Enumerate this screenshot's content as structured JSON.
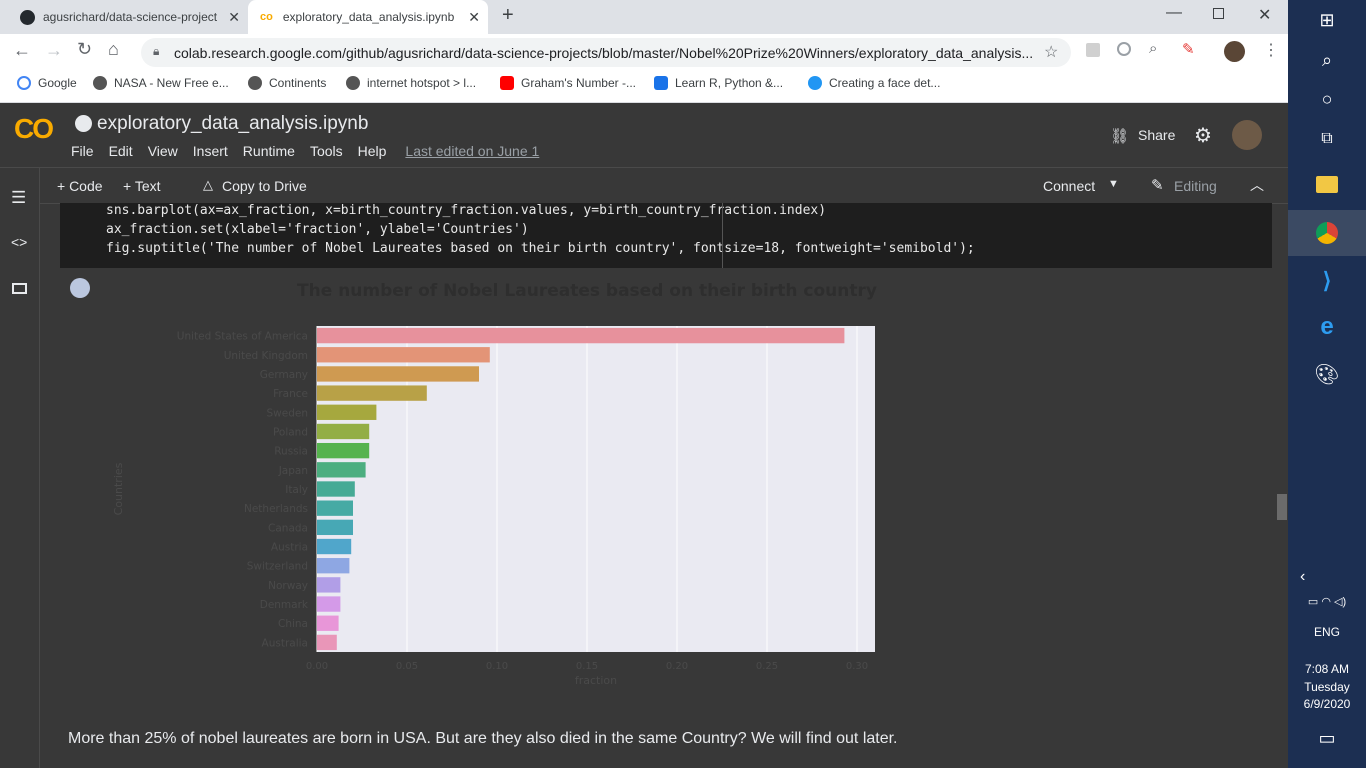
{
  "browser": {
    "tabs": [
      {
        "title": "agusrichard/data-science-project",
        "icon": "github-icon"
      },
      {
        "title": "exploratory_data_analysis.ipynb -",
        "icon": "colab-icon"
      }
    ],
    "url": "colab.research.google.com/github/agusrichard/data-science-projects/blob/master/Nobel%20Prize%20Winners/exploratory_data_analysis...",
    "bookmarks": [
      {
        "label": "Google",
        "color": "#4285f4"
      },
      {
        "label": "NASA - New Free e...",
        "color": "#555555"
      },
      {
        "label": "Continents",
        "color": "#555555"
      },
      {
        "label": "internet hotspot > l...",
        "color": "#555555"
      },
      {
        "label": "Graham's Number -...",
        "color": "#ff0000"
      },
      {
        "label": "Learn R, Python &...",
        "color": "#1a73e8"
      },
      {
        "label": "Creating a face det...",
        "color": "#2196f3"
      }
    ]
  },
  "colab": {
    "logo": "CO",
    "notebook_title": "exploratory_data_analysis.ipynb",
    "menu": [
      "File",
      "Edit",
      "View",
      "Insert",
      "Runtime",
      "Tools",
      "Help"
    ],
    "last_edited": "Last edited on June 1",
    "share_label": "Share",
    "add_code": "+ Code",
    "add_text": "+ Text",
    "copy_to_drive": "Copy to Drive",
    "connect": "Connect",
    "editing": "Editing"
  },
  "code_lines": [
    "sns.barplot(ax=ax_fraction, x=birth_country_fraction.values, y=birth_country_fraction.index)",
    "ax_fraction.set(xlabel='fraction', ylabel='Countries')",
    "fig.suptitle('The number of Nobel Laureates based on their birth country', fontsize=18, fontweight='semibold');"
  ],
  "chart_data": {
    "type": "bar",
    "orientation": "horizontal",
    "title": "The number of Nobel Laureates based on their birth country",
    "xlabel": "fraction",
    "ylabel": "Countries",
    "xlim": [
      0,
      0.31
    ],
    "xticks": [
      "0.00",
      "0.05",
      "0.10",
      "0.15",
      "0.20",
      "0.25",
      "0.30"
    ],
    "grid": true,
    "categories": [
      "United States of America",
      "United Kingdom",
      "Germany",
      "France",
      "Sweden",
      "Poland",
      "Russia",
      "Japan",
      "Italy",
      "Netherlands",
      "Canada",
      "Austria",
      "Switzerland",
      "Norway",
      "Denmark",
      "China",
      "Australia"
    ],
    "values": [
      0.293,
      0.096,
      0.09,
      0.061,
      0.033,
      0.029,
      0.029,
      0.027,
      0.021,
      0.02,
      0.02,
      0.019,
      0.018,
      0.013,
      0.013,
      0.012,
      0.011
    ],
    "colors": [
      "#e7919c",
      "#e39477",
      "#cf9a51",
      "#b8a147",
      "#a6a83e",
      "#93ae45",
      "#56b34e",
      "#4cae80",
      "#46aa95",
      "#46aaa4",
      "#47a8b5",
      "#50a6cb",
      "#8ea7e3",
      "#b19ee7",
      "#d49ae8",
      "#e896d8",
      "#e996b8"
    ]
  },
  "summary": "More than 25% of nobel laureates are born in USA. But are they also died in the same Country? We will find out later.",
  "taskbar": {
    "lang": "ENG",
    "time": "7:08 AM",
    "day": "Tuesday",
    "date": "6/9/2020"
  }
}
